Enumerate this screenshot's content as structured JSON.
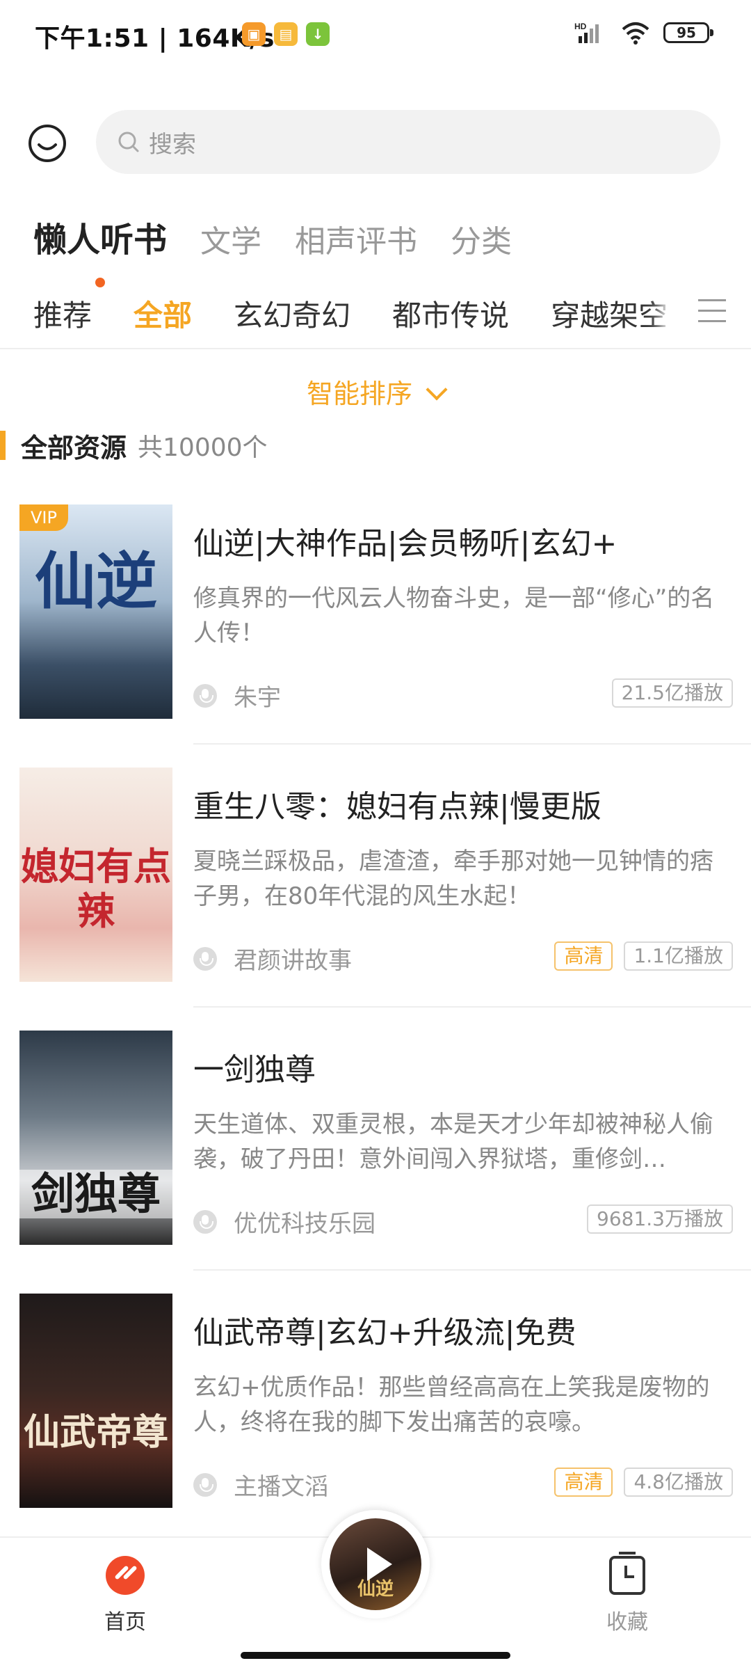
{
  "status_bar": {
    "time": "下午1:51 | 164K/s",
    "battery": "95",
    "network_label": "HD"
  },
  "search": {
    "placeholder": "搜索"
  },
  "main_tabs": [
    {
      "label": "懒人听书",
      "active": true
    },
    {
      "label": "文学",
      "active": false
    },
    {
      "label": "相声评书",
      "active": false
    },
    {
      "label": "分类",
      "active": false
    }
  ],
  "category_tabs": [
    {
      "label": "推荐",
      "active": false
    },
    {
      "label": "全部",
      "active": true
    },
    {
      "label": "玄幻奇幻",
      "active": false
    },
    {
      "label": "都市传说",
      "active": false
    },
    {
      "label": "穿越架空",
      "active": false
    }
  ],
  "sort": {
    "label": "智能排序"
  },
  "section": {
    "title": "全部资源",
    "count": "共10000个"
  },
  "items": [
    {
      "cover_text": "仙逆",
      "vip_badge": "VIP",
      "title": "仙逆|大神作品|会员畅听|玄幻+",
      "desc": "修真界的一代风云人物奋斗史，是一部“修心”的名人传！",
      "author": "朱宇",
      "hd": "",
      "plays": "21.5亿播放"
    },
    {
      "cover_text": "媳妇有点辣",
      "vip_badge": "",
      "title": "重生八零：媳妇有点辣|慢更版",
      "desc": "夏晓兰踩极品，虐渣渣，牵手那对她一见钟情的痞子男，在80年代混的风生水起！",
      "author": "君颜讲故事",
      "hd": "高清",
      "plays": "1.1亿播放"
    },
    {
      "cover_text": "剑独尊",
      "vip_badge": "",
      "title": "一剑独尊",
      "desc": "天生道体、双重灵根，本是天才少年却被神秘人偷袭，破了丹田！意外间闯入界狱塔，重修剑…",
      "author": "优优科技乐园",
      "hd": "",
      "plays": "9681.3万播放"
    },
    {
      "cover_text": "仙武帝尊",
      "vip_badge": "",
      "title": "仙武帝尊|玄幻+升级流|免费",
      "desc": "玄幻+优质作品！那些曾经高高在上笑我是废物的人，终将在我的脚下发出痛苦的哀嚎。",
      "author": "主播文滔",
      "hd": "高清",
      "plays": "4.8亿播放"
    }
  ],
  "bottom_nav": {
    "home": "首页",
    "favorites": "收藏",
    "player_cover_text": "仙逆"
  },
  "colors": {
    "accent": "#f5a623",
    "home_red": "#f04a2a",
    "tab_dot": "#f26522"
  }
}
